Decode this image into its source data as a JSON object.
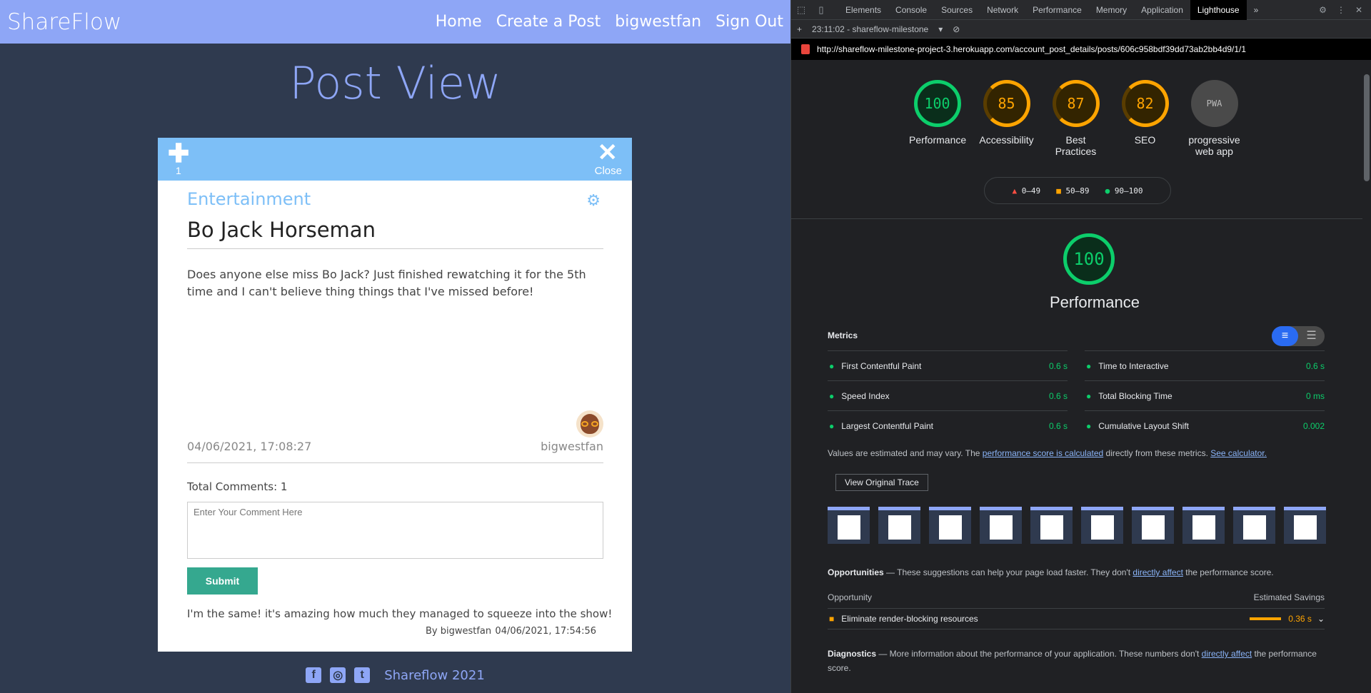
{
  "app": {
    "brand": "ShareFlow",
    "nav": [
      "Home",
      "Create a Post",
      "bigwestfan",
      "Sign Out"
    ],
    "page_title": "Post View"
  },
  "post": {
    "plus_icon": "plus-icon",
    "votes": "1",
    "close_label": "Close",
    "category": "Entertainment",
    "title": "Bo Jack Horseman",
    "body": "Does anyone else miss Bo Jack? Just finished rewatching it for the 5th time and I can't believe thing things that I've missed before!",
    "date": "04/06/2021, 17:08:27",
    "author": "bigwestfan",
    "total_comments": "Total Comments: 1",
    "comment_placeholder": "Enter Your Comment Here",
    "submit_label": "Submit",
    "comments": [
      {
        "text": "I'm the same! it's amazing how much they managed to squeeze into the show!",
        "by": "By bigwestfan",
        "date": "04/06/2021, 17:54:56"
      }
    ]
  },
  "footer": {
    "copyright": "Shareflow 2021",
    "icons": [
      "facebook-icon",
      "instagram-icon",
      "twitter-icon"
    ]
  },
  "devtools": {
    "tabs": [
      "Elements",
      "Console",
      "Sources",
      "Network",
      "Performance",
      "Memory",
      "Application",
      "Lighthouse"
    ],
    "active_tab": "Lighthouse",
    "report_label": "23:11:02 - shareflow-milestone",
    "url": "http://shareflow-milestone-project-3.herokuapp.com/account_post_details/posts/606c958bdf39dd73ab2bb4d9/1/1",
    "scores": [
      {
        "label": "Performance",
        "value": "100",
        "tier": "green"
      },
      {
        "label": "Accessibility",
        "value": "85",
        "tier": "orange"
      },
      {
        "label": "Best Practices",
        "value": "87",
        "tier": "orange"
      },
      {
        "label": "SEO",
        "value": "82",
        "tier": "orange"
      },
      {
        "label": "progressive web app",
        "value": "PWA",
        "tier": "pwa"
      }
    ],
    "legend": [
      "0–49",
      "50–89",
      "90–100"
    ],
    "perf_score": "100",
    "perf_label": "Performance",
    "metrics_label": "Metrics",
    "metrics": [
      {
        "name": "First Contentful Paint",
        "value": "0.6 s"
      },
      {
        "name": "Time to Interactive",
        "value": "0.6 s"
      },
      {
        "name": "Speed Index",
        "value": "0.6 s"
      },
      {
        "name": "Total Blocking Time",
        "value": "0 ms"
      },
      {
        "name": "Largest Contentful Paint",
        "value": "0.6 s"
      },
      {
        "name": "Cumulative Layout Shift",
        "value": "0.002"
      }
    ],
    "values_note_1": "Values are estimated and may vary. The ",
    "values_link_1": "performance score is calculated",
    "values_note_2": " directly from these metrics. ",
    "values_link_2": "See calculator.",
    "trace_label": "View Original Trace",
    "opp_title": "Opportunities",
    "opp_text": " — These suggestions can help your page load faster. They don't ",
    "opp_link": "directly affect",
    "opp_text2": " the performance score.",
    "opp_col1": "Opportunity",
    "opp_col2": "Estimated Savings",
    "opp_item": "Eliminate render-blocking resources",
    "opp_saving": "0.36 s",
    "diag_title": "Diagnostics",
    "diag_text": " — More information about the performance of your application. These numbers don't ",
    "diag_link": "directly affect",
    "diag_text2": " the performance score."
  }
}
